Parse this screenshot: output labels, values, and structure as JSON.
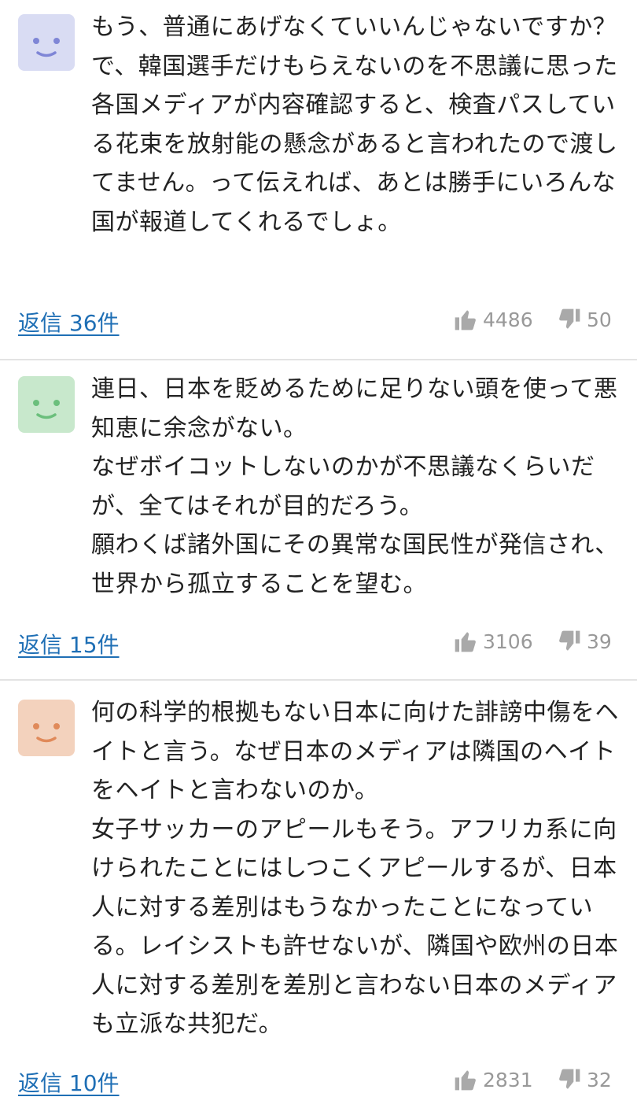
{
  "comments": [
    {
      "avatar_color": "#d9dcf3",
      "face_color": "#7f86d6",
      "text": "もう、普通にあげなくていいんじゃないですか？\nで、韓国選手だけもらえないのを不思議に思った各国メディアが内容確認すると、検査パスしている花束を放射能の懸念があると言われたので渡してません。って伝えれば、あとは勝手にいろんな国が報道してくれるでしょ。",
      "reply_label": "返信 36件",
      "likes": "4486",
      "dislikes": "50"
    },
    {
      "avatar_color": "#c8e8cc",
      "face_color": "#6bbf7c",
      "text": "連日、日本を貶めるために足りない頭を使って悪知恵に余念がない。\nなぜボイコットしないのかが不思議なくらいだが、全てはそれが目的だろう。\n願わくば諸外国にその異常な国民性が発信され、世界から孤立することを望む。",
      "reply_label": "返信 15件",
      "likes": "3106",
      "dislikes": "39"
    },
    {
      "avatar_color": "#f3d2bd",
      "face_color": "#e08a5a",
      "text": "何の科学的根拠もない日本に向けた誹謗中傷をヘイトと言う。なぜ日本のメディアは隣国のヘイトをヘイトと言わないのか。\n女子サッカーのアピールもそう。アフリカ系に向けられたことにはしつこくアピールするが、日本人に対する差別はもうなかったことになっている。レイシストも許せないが、隣国や欧州の日本人に対する差別を差別と言わない日本のメディアも立派な共犯だ。",
      "reply_label": "返信 10件",
      "likes": "2831",
      "dislikes": "32"
    }
  ]
}
